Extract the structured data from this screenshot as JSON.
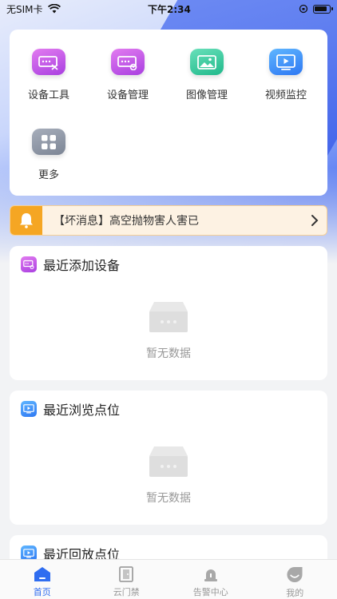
{
  "status_bar": {
    "carrier": "无SIM卡",
    "time": "下午2:34"
  },
  "tools": [
    {
      "label": "设备工具",
      "icon": "device-tool-icon",
      "color": "#b94ee6"
    },
    {
      "label": "设备管理",
      "icon": "device-manage-icon",
      "color": "#b94ee6"
    },
    {
      "label": "图像管理",
      "icon": "image-icon",
      "color": "#26c190"
    },
    {
      "label": "视频监控",
      "icon": "video-monitor-icon",
      "color": "#3a86f5"
    },
    {
      "label": "更多",
      "icon": "grid-icon",
      "color": "#8a93a2"
    }
  ],
  "notice": {
    "text": "【坏消息】高空抛物害人害已",
    "accent": "#f5a623"
  },
  "sections": {
    "recent_devices": {
      "title": "最近添加设备",
      "empty_text": "暂无数据"
    },
    "recent_browsed": {
      "title": "最近浏览点位",
      "empty_text": "暂无数据"
    },
    "recent_playback": {
      "title": "最近回放点位"
    }
  },
  "tabbar": {
    "items": [
      {
        "label": "首页",
        "icon": "home-icon",
        "active": true
      },
      {
        "label": "云门禁",
        "icon": "door-icon",
        "active": false
      },
      {
        "label": "告警中心",
        "icon": "alarm-icon",
        "active": false
      },
      {
        "label": "我的",
        "icon": "profile-icon",
        "active": false
      }
    ],
    "active_color": "#2f6df0"
  }
}
